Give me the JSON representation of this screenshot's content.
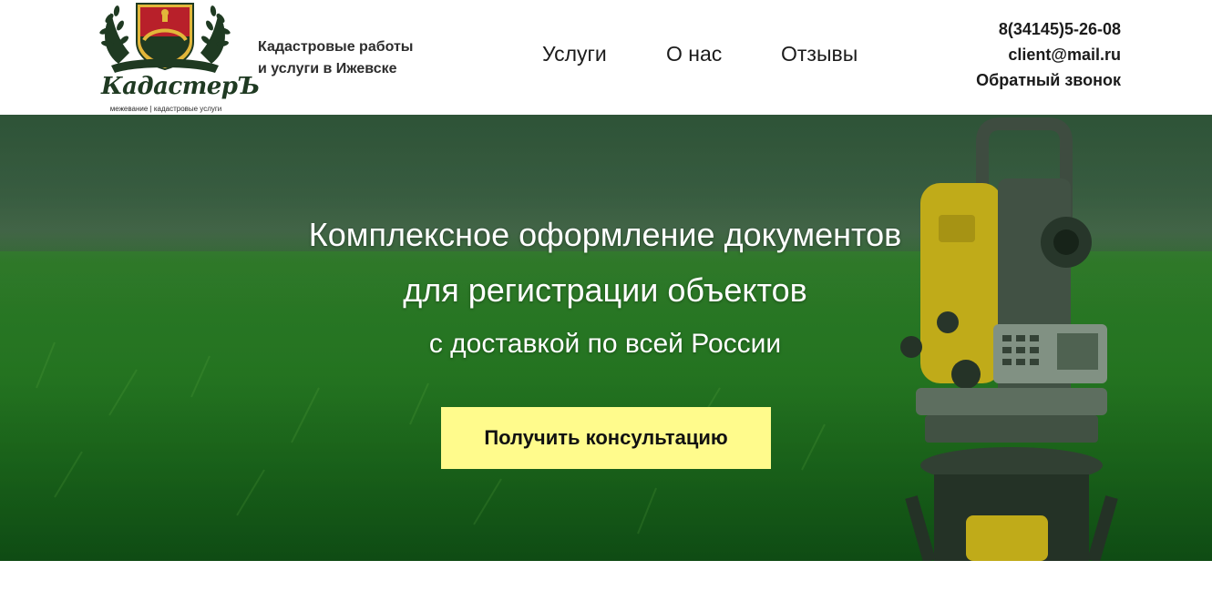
{
  "header": {
    "logo": {
      "name": "КадастерЪ",
      "subtitle": "межевание | кадастровые услуги",
      "colors": {
        "shield_red": "#b8202a",
        "shield_gold": "#e2b73a",
        "dark_green": "#1f3a22"
      }
    },
    "tagline": {
      "line1": "Кадастровые работы",
      "line2": "и услуги в Ижевске"
    },
    "nav": [
      {
        "label": "Услуги"
      },
      {
        "label": "О нас"
      },
      {
        "label": "Отзывы"
      }
    ],
    "contacts": {
      "phone": "8(34145)5-26-08",
      "email": "client@mail.ru",
      "callback": "Обратный звонок"
    }
  },
  "hero": {
    "title_line1": "Комплексное оформление документов",
    "title_line2": "для регистрации объектов",
    "subtitle": "с доставкой по всей России",
    "cta_label": "Получить консультацию",
    "colors": {
      "cta_background": "#fffb8c",
      "grass": "#2c8f24",
      "instrument_yellow": "#e8c21a"
    }
  }
}
